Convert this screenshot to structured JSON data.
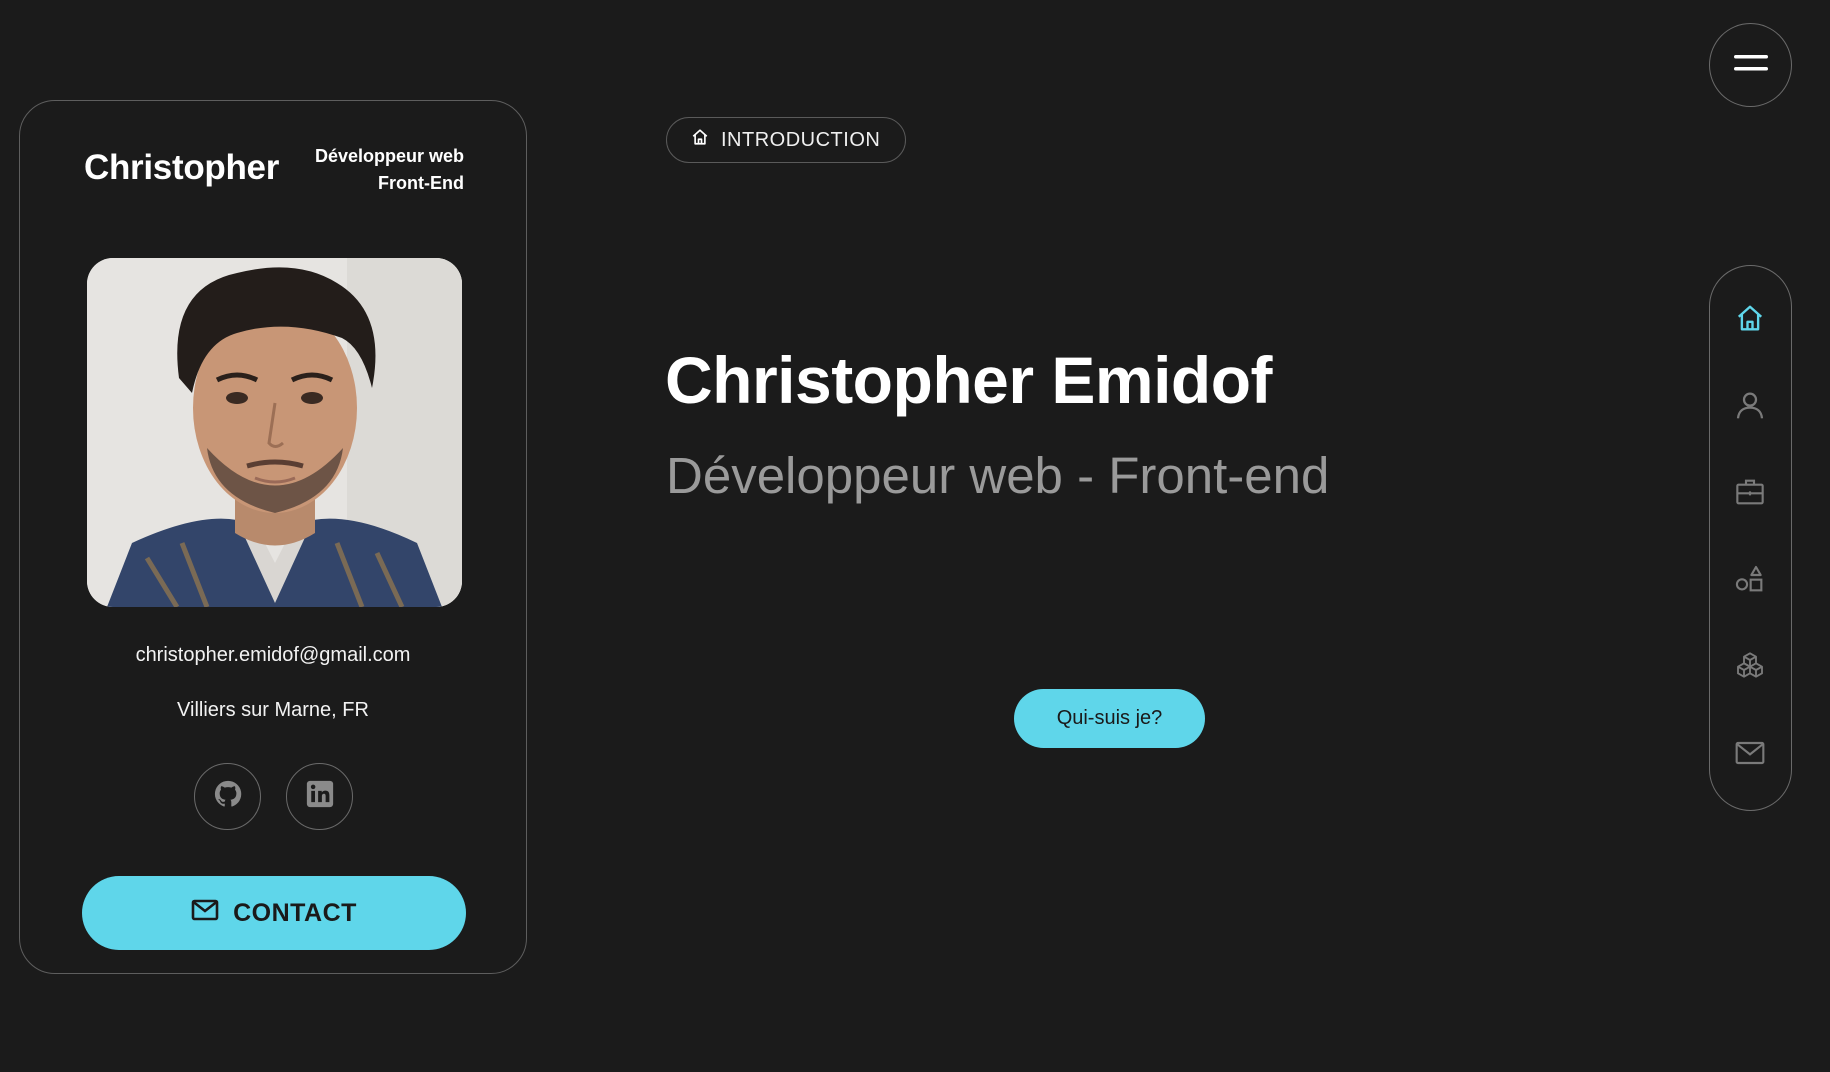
{
  "profile": {
    "name": "Christopher",
    "role_line1": "Développeur web",
    "role_line2": "Front-End",
    "photo_icon": "profile-photo",
    "email": "christopher.emidof@gmail.com",
    "location": "Villiers sur Marne, FR",
    "social": [
      {
        "icon": "github-icon"
      },
      {
        "icon": "linkedin-icon"
      }
    ],
    "contact_label": "CONTACT"
  },
  "hero": {
    "section_label": "INTRODUCTION",
    "title": "Christopher Emidof",
    "subtitle": "Développeur web - Front-end",
    "cta_label": "Qui-suis je?"
  },
  "nav": {
    "menu_icon": "hamburger-icon",
    "items": [
      {
        "icon": "home-icon",
        "active": true
      },
      {
        "icon": "user-icon",
        "active": false
      },
      {
        "icon": "briefcase-icon",
        "active": false
      },
      {
        "icon": "shapes-icon",
        "active": false
      },
      {
        "icon": "cubes-icon",
        "active": false
      },
      {
        "icon": "mail-icon",
        "active": false
      }
    ]
  },
  "colors": {
    "background": "#1b1b1b",
    "accent": "#5fd6ea",
    "border": "#5e5e5e",
    "muted_text": "#9a9a9a",
    "icon_inactive": "#7a7a7a"
  }
}
